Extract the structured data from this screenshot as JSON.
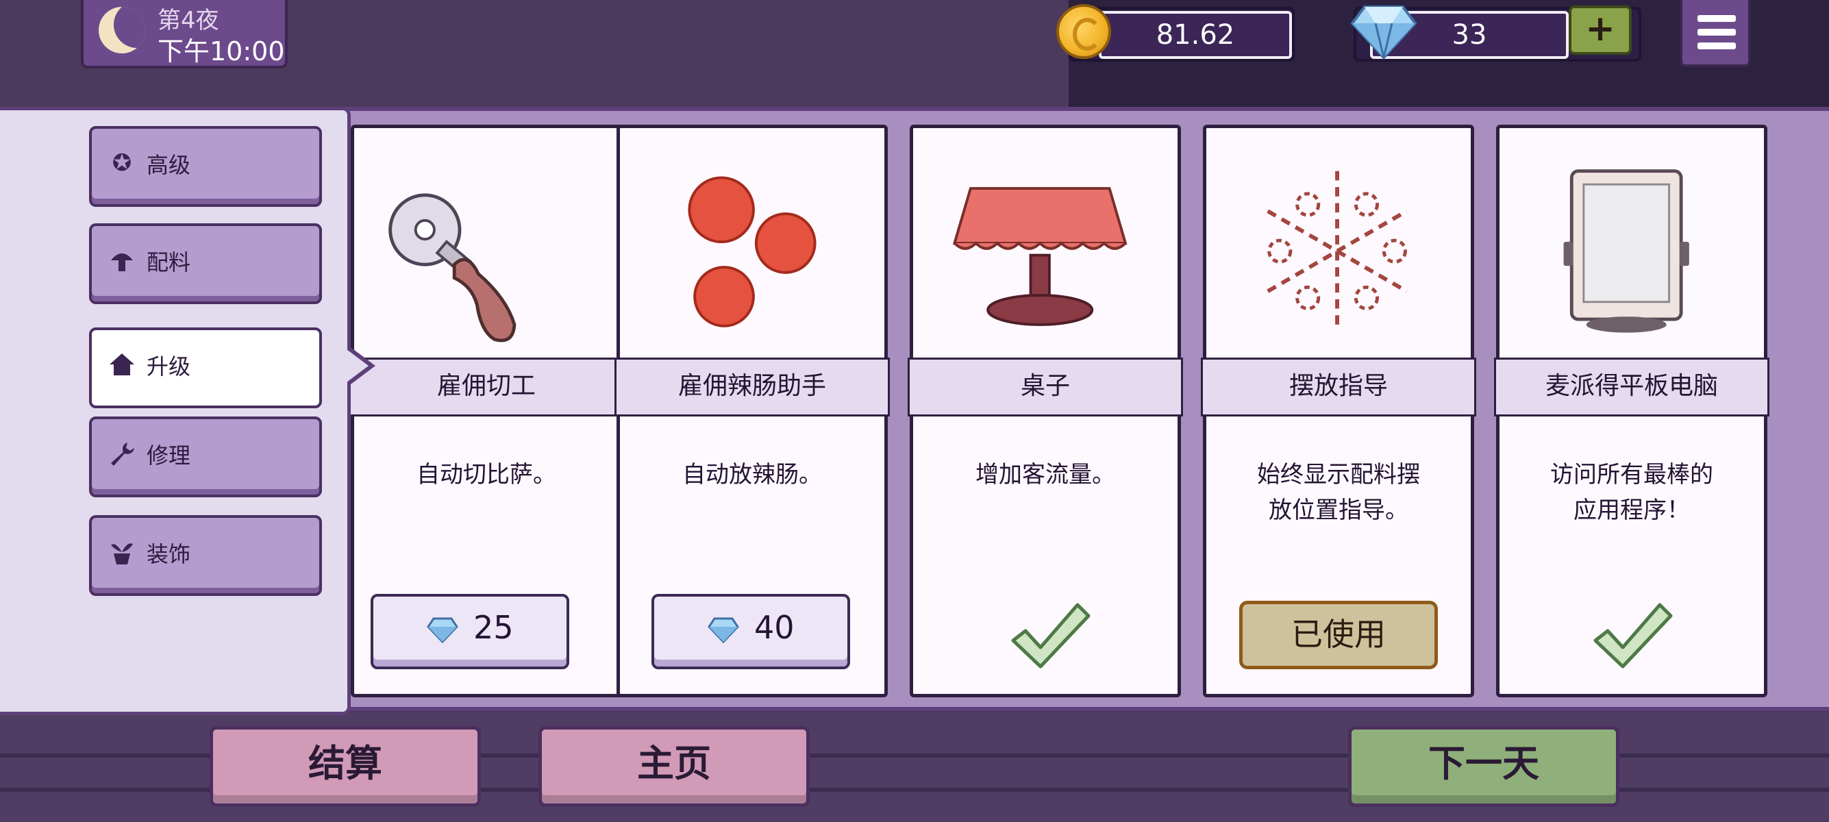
{
  "top_bar": {
    "night_label": "第4夜",
    "time": "下午10:00",
    "coins": "81.62",
    "gems": "33",
    "plus_label": "+"
  },
  "sidebar": {
    "items": [
      {
        "label": "高级",
        "icon": "star-badge-icon"
      },
      {
        "label": "配料",
        "icon": "mushroom-icon"
      },
      {
        "label": "升级",
        "icon": "house-icon",
        "active": true
      },
      {
        "label": "修理",
        "icon": "wrench-icon"
      },
      {
        "label": "装饰",
        "icon": "plant-pot-icon"
      }
    ]
  },
  "cards": [
    {
      "title": "雇佣切工",
      "desc": "自动切比萨。",
      "status": "buy",
      "price": "25",
      "icon": "pizza-cutter-icon"
    },
    {
      "title": "雇佣辣肠助手",
      "desc": "自动放辣肠。",
      "status": "buy",
      "price": "40",
      "icon": "pepperoni-icon"
    },
    {
      "title": "桌子",
      "desc": "增加客流量。",
      "status": "owned",
      "icon": "table-icon"
    },
    {
      "title": "摆放指导",
      "desc": "始终显示配料摆放位置指导。",
      "desc_line1": "始终显示配料摆",
      "desc_line2": "放位置指导。",
      "status": "in_use",
      "status_label": "已使用",
      "icon": "placement-guide-icon"
    },
    {
      "title": "麦派得平板电脑",
      "desc": "访问所有最棒的应用程序！",
      "desc_line1": "访问所有最棒的",
      "desc_line2": "应用程序！",
      "status": "owned",
      "icon": "tablet-icon"
    }
  ],
  "bottom": {
    "settle_label": "结算",
    "home_label": "主页",
    "next_label": "下一天"
  },
  "colors": {
    "panel": "#a98fc0",
    "button_pink": "#d19ab7",
    "button_green": "#8fb07a",
    "used_button": "#cdc29b"
  }
}
